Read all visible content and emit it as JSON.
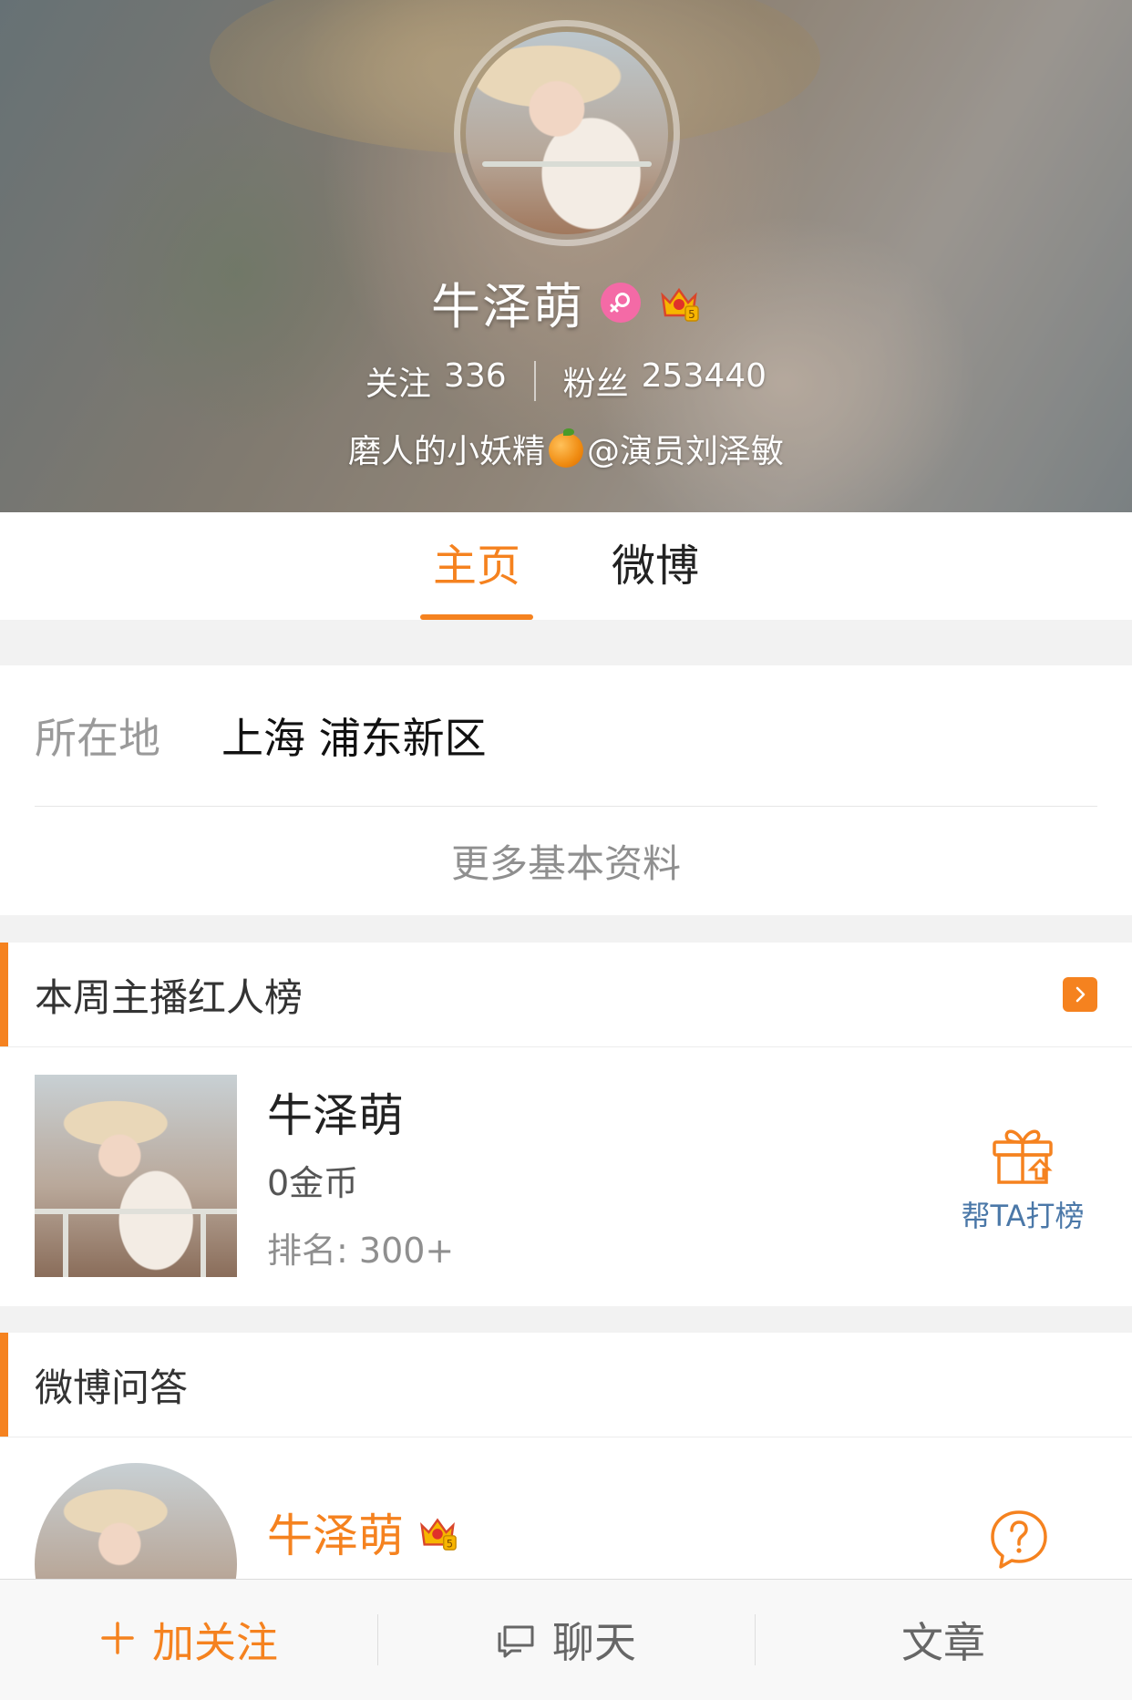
{
  "profile": {
    "name": "牛泽萌",
    "following_label": "关注",
    "following_count": "336",
    "fans_label": "粉丝",
    "fans_count": "253440",
    "bio_prefix": "磨人的小妖精",
    "bio_suffix": "@演员刘泽敏"
  },
  "tabs": [
    {
      "label": "主页",
      "active": true
    },
    {
      "label": "微博",
      "active": false
    }
  ],
  "info": {
    "location_label": "所在地",
    "location_value": "上海 浦东新区",
    "more_label": "更多基本资料"
  },
  "ranking": {
    "title": "本周主播红人榜",
    "name": "牛泽萌",
    "coins": "0金币",
    "rank_label": "排名:",
    "rank_value": "300+",
    "help_label": "帮TA打榜"
  },
  "qa": {
    "title": "微博问答",
    "name": "牛泽萌"
  },
  "bottom_bar": {
    "follow": "加关注",
    "chat": "聊天",
    "article": "文章"
  },
  "colors": {
    "accent": "#f5821f",
    "link_blue": "#4b78a8",
    "gender_pink": "#f46aa6"
  }
}
